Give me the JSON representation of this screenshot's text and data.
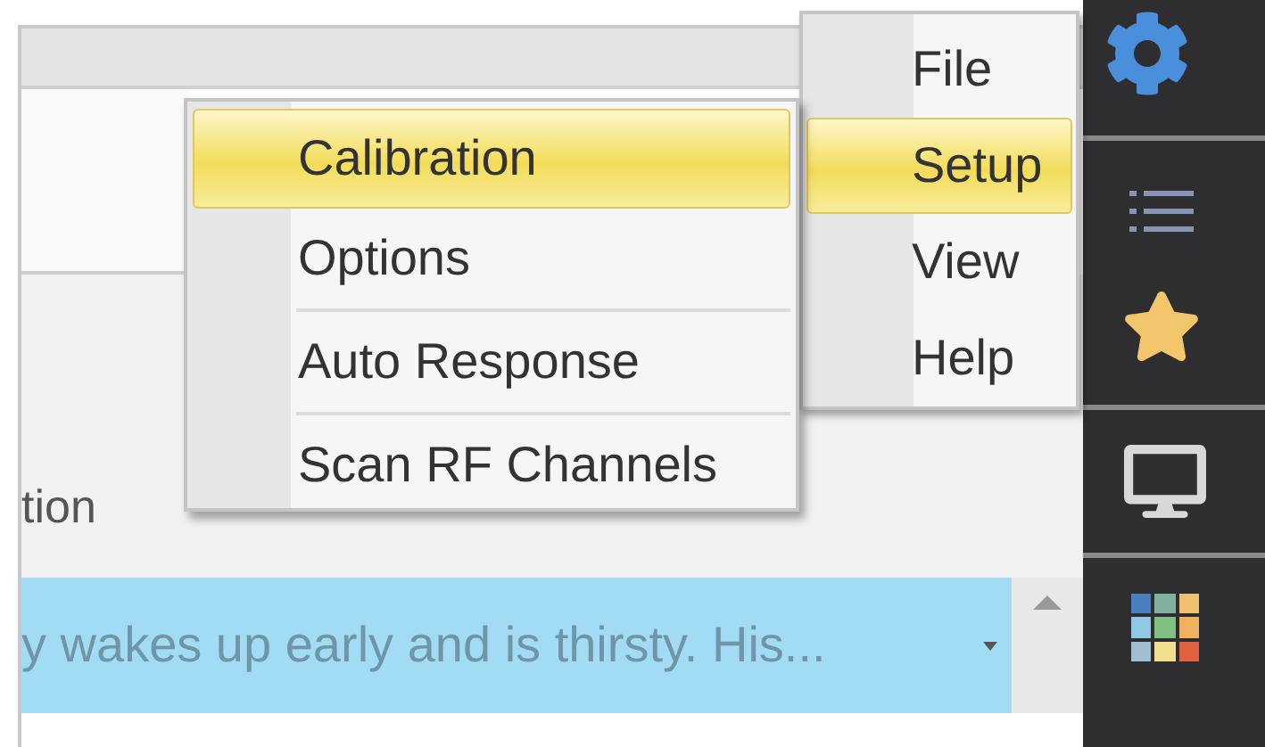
{
  "menu": {
    "items": [
      {
        "label": "File",
        "selected": false
      },
      {
        "label": "Setup",
        "selected": true
      },
      {
        "label": "View",
        "selected": false
      },
      {
        "label": "Help",
        "selected": false
      }
    ]
  },
  "submenu": {
    "items": [
      {
        "label": "Calibration",
        "selected": true
      },
      {
        "label": "Options",
        "selected": false
      },
      {
        "label": "Auto Response",
        "selected": false
      },
      {
        "label": "Scan RF Channels",
        "selected": false
      }
    ]
  },
  "table": {
    "column_header": "tion",
    "row": {
      "text": "y wakes up early and is thirsty.  His...",
      "selected": true
    }
  }
}
